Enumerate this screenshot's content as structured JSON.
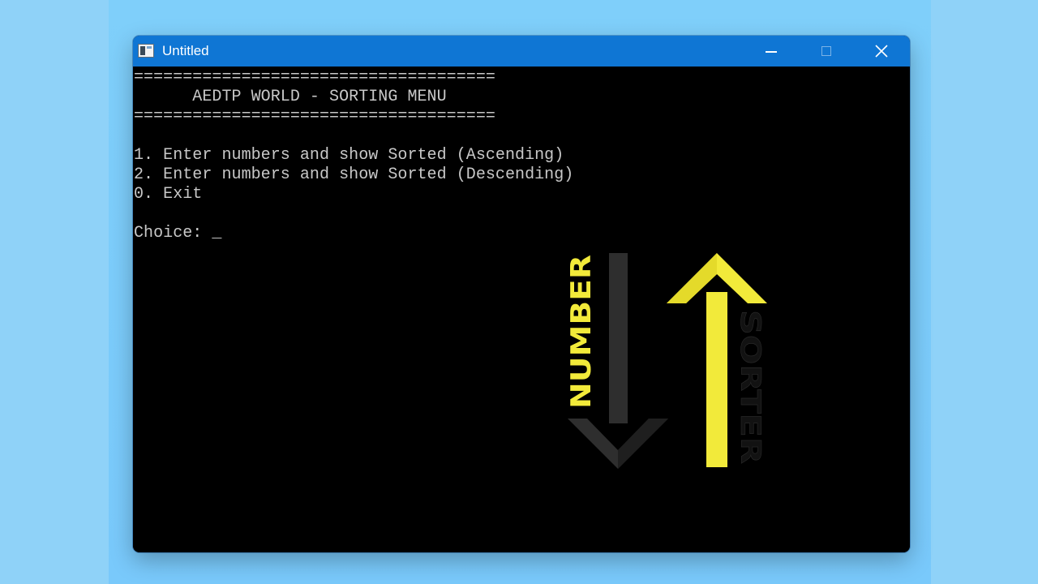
{
  "window": {
    "title": "Untitled",
    "controls": {
      "minimize": "minimize",
      "maximize": "maximize",
      "close": "close"
    }
  },
  "console": {
    "lines": [
      "=====================================",
      "      AEDTP WORLD - SORTING MENU",
      "=====================================",
      "",
      "1. Enter numbers and show Sorted (Ascending)",
      "2. Enter numbers and show Sorted (Descending)",
      "0. Exit",
      "",
      "Choice: _"
    ]
  },
  "logo": {
    "word_left": "NUMBER",
    "word_right": "SORTER",
    "colors": {
      "accent": "#f2ea3a",
      "arrow_down": "#2e2e2e",
      "text_dark": "#111111"
    }
  },
  "colors": {
    "titlebar": "#0f76d4",
    "console_bg": "#000000",
    "console_text": "#c8c8c8",
    "desktop": "#8fd2f8"
  }
}
